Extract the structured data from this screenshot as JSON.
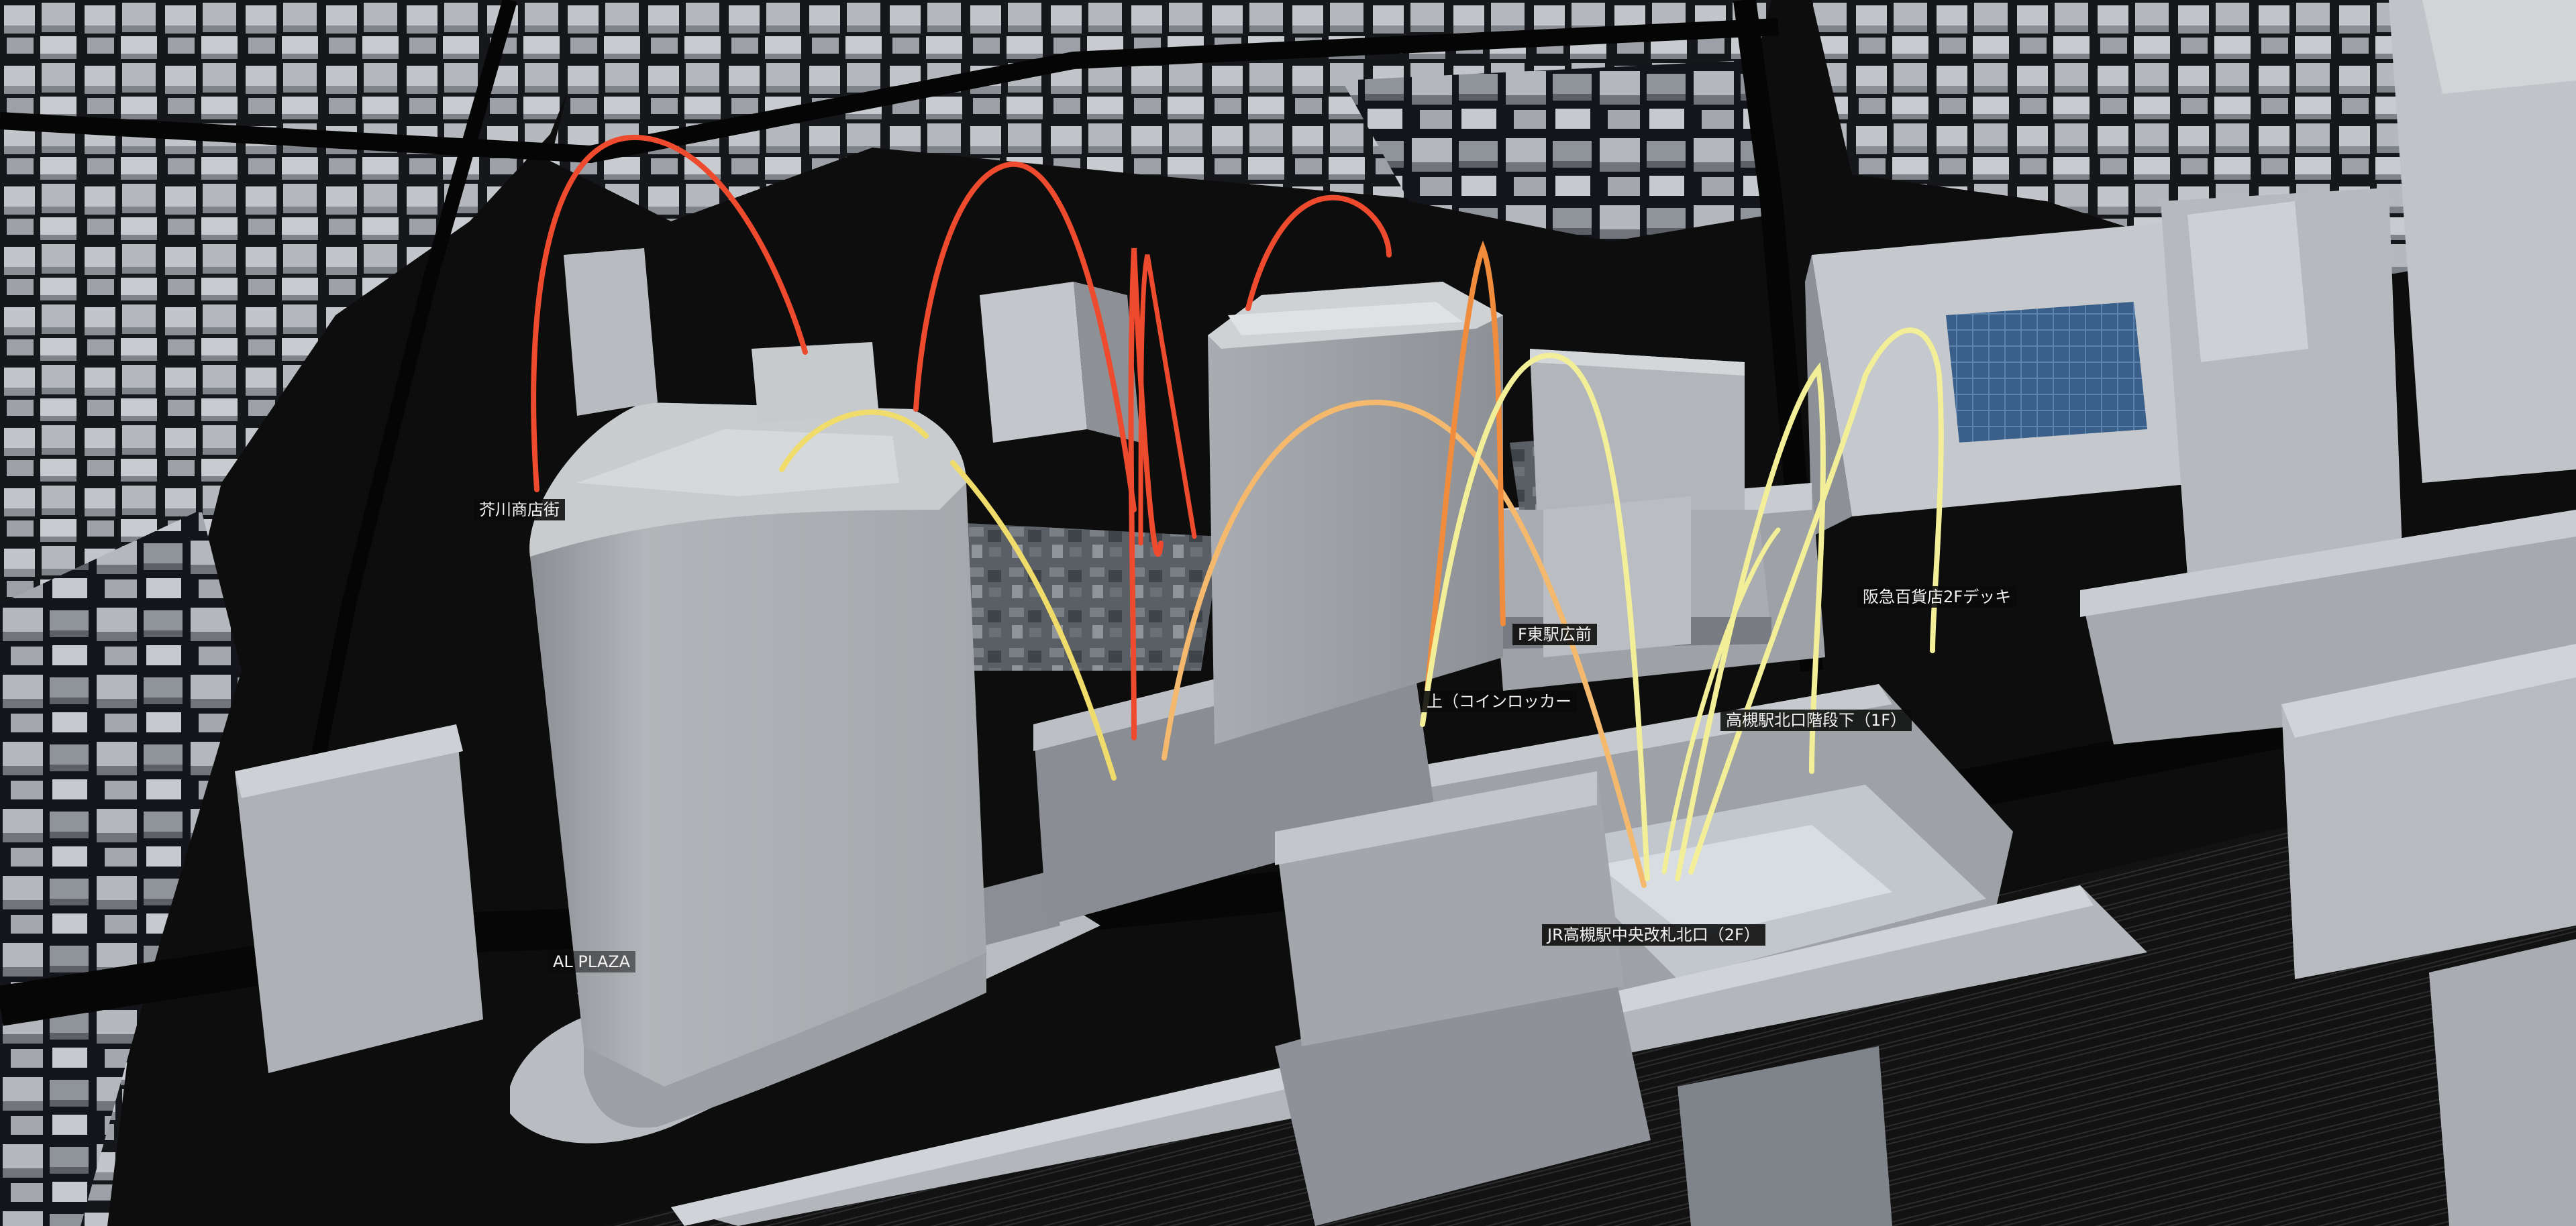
{
  "map": {
    "labels": {
      "akutagawa": "芥川商店街",
      "al_plaza": "AL PLAZA",
      "f_east": "F東駅広前",
      "coin_locker": "上（コインロッカー",
      "jr_north_stairs": "高槻駅北口階段下（1F）",
      "hankyu_deck": "阪急百貨店2Fデッキ",
      "jr_central_gate": "JR高槻駅中央改札北口（2F）"
    },
    "arc_colors": {
      "red": "#ee4a2e",
      "orange": "#f08c3c",
      "light_orange": "#f5b96e",
      "yellow": "#f0dc6a",
      "pale_yellow": "#f2ef98"
    },
    "building_colors": {
      "roof": "#c4c7cb",
      "wall_light": "#a5a8ad",
      "wall_dark": "#7c8086",
      "ground": "#101011",
      "road": "#1c1c1d"
    }
  }
}
